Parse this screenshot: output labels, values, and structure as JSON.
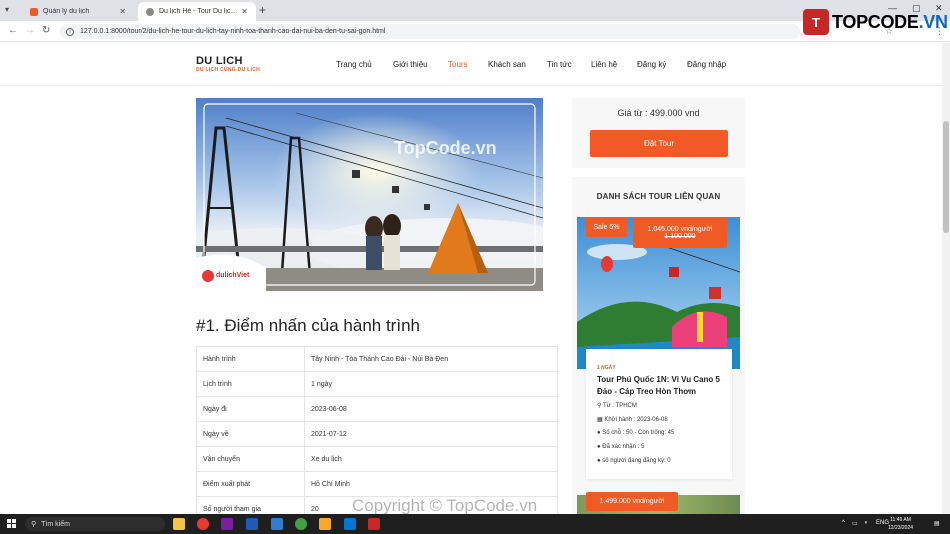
{
  "browser": {
    "tabs": [
      {
        "title": "Quản lý du lịch"
      },
      {
        "title": "Du lịch Hè - Tour Du lịch Tây Ni..."
      }
    ],
    "url": "127.0.0.1:8000/tour/2/du-lich-he-tour-du-lich-tay-ninh-toa-thanh-cao-dai-nui-ba-den-tu-sai-gon.html"
  },
  "logo": {
    "main": "TOPCODE",
    "suffix": ".VN"
  },
  "site": {
    "brand": "DU LICH",
    "tagline": "DU LỊCH CÙNG DU LỊCH",
    "menu": [
      "Trang chủ",
      "Giới thiệu",
      "Tours",
      "Khách san",
      "Tin tức",
      "Liên hệ",
      "Đăng ký",
      "Đăng nhập"
    ],
    "active_menu": "Tours"
  },
  "hero": {
    "brand_logo": "dulichViet",
    "watermark": "TopCode.vn"
  },
  "section_title": "#1. Điểm nhấn của hành trình",
  "details": [
    {
      "label": "Hành trình",
      "value": "Tây Ninh - Tòa Thánh Cao Đài - Núi Bà Đen"
    },
    {
      "label": "Lịch trình",
      "value": "1 ngày"
    },
    {
      "label": "Ngày đi",
      "value": "2023-06-08"
    },
    {
      "label": "Ngày về",
      "value": "2021-07-12"
    },
    {
      "label": "Vận chuyển",
      "value": "Xe du lịch"
    },
    {
      "label": "Điểm xuất phát",
      "value": "Hồ Chí Minh"
    },
    {
      "label": "Số người tham gia",
      "value": "20"
    }
  ],
  "sidebar": {
    "price": "Giá từ : 499.000 vnd",
    "book_button": "Đặt Tour",
    "related_title": "DANH SÁCH TOUR LIÊN QUAN",
    "tours": [
      {
        "sale": "Sale 5%",
        "price": "1.045.000 vnd/người",
        "old_price": "1.100.000",
        "days": "1 NGÀY",
        "title": "Tour Phú Quốc 1N: Vi Vu Cano 5 Đảo - Cáp Treo Hòn Thơm",
        "from": "Từ : TPHCM",
        "start": "Khởi hành : 2023-06-08",
        "seats": "Số chỗ : 50 - Còn trống: 45",
        "confirmed": "Đã xác nhận : 5",
        "registered": "số người đang đăng ký: 0"
      },
      {
        "price": "1.499.000 vnd/người"
      }
    ]
  },
  "watermark": "Copyright © TopCode.vn",
  "taskbar": {
    "search": "Tìm kiếm",
    "lang": "ENG",
    "time": "11:49 AM",
    "date": "12/23/2024"
  }
}
